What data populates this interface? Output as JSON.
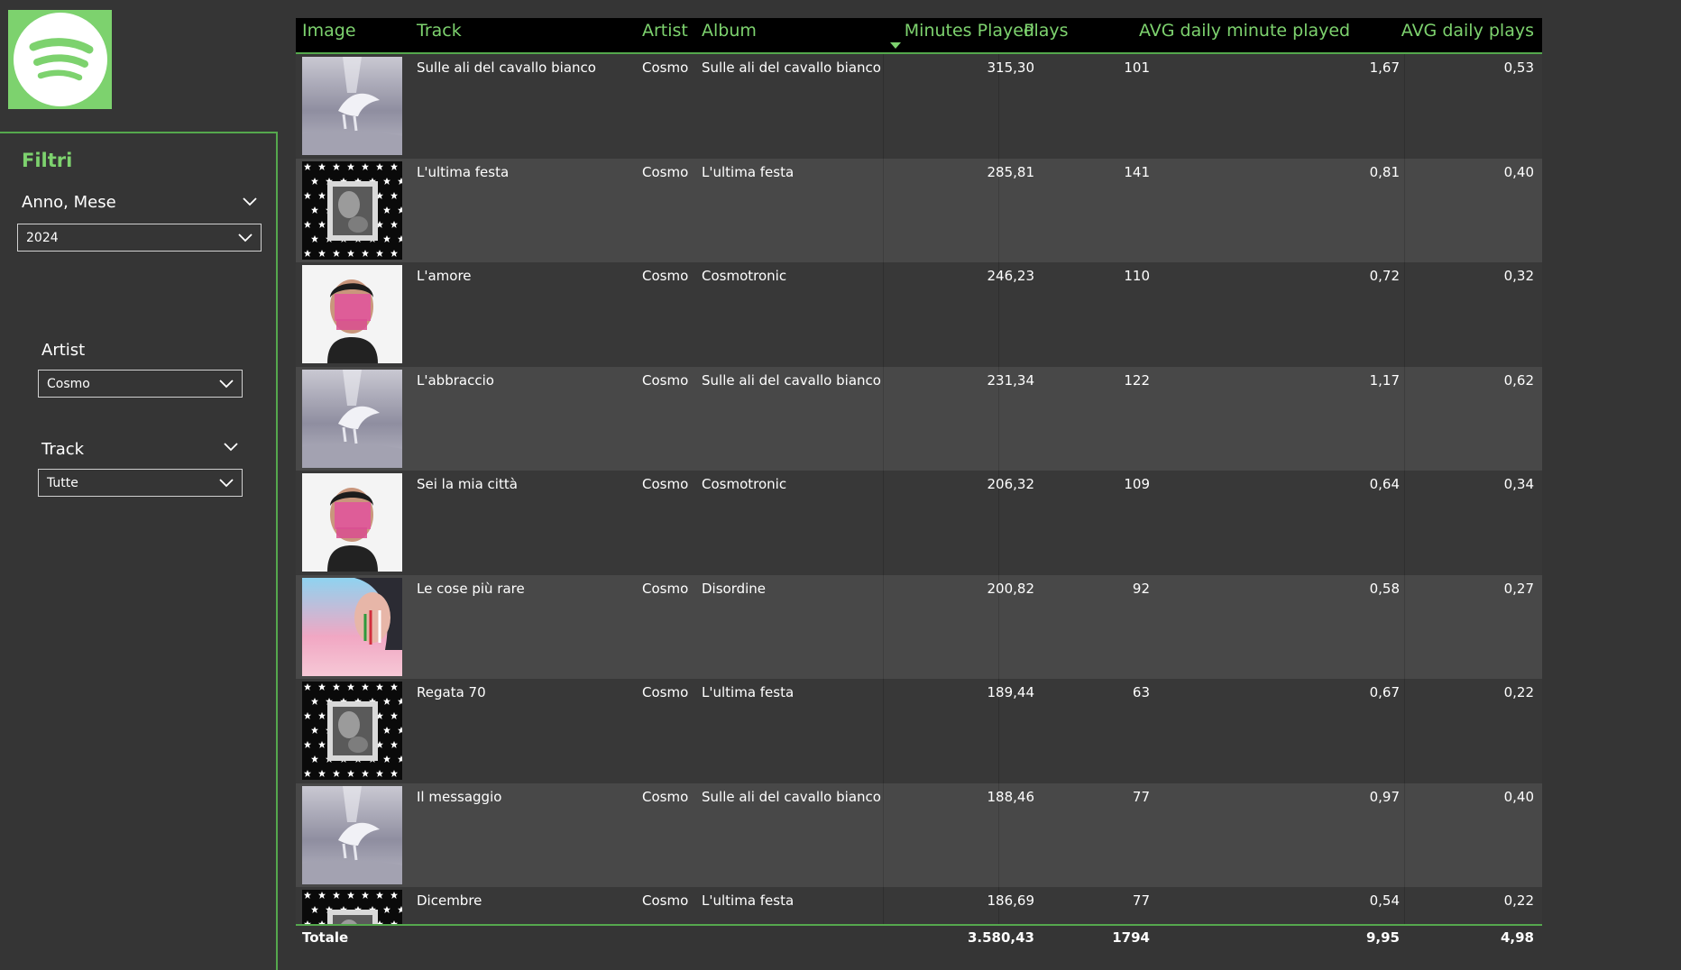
{
  "filters": {
    "title": "Filtri",
    "slicers": [
      {
        "label": "Anno, Mese",
        "value": "2024"
      },
      {
        "label": "Artist",
        "value": "Cosmo"
      },
      {
        "label": "Track",
        "value": "Tutte"
      }
    ]
  },
  "table": {
    "columns": [
      "Image",
      "Track",
      "Artist",
      "Album",
      "Minutes Played",
      "Plays",
      "AVG daily minute played",
      "AVG daily plays"
    ],
    "sorted_column": "Minutes Played",
    "sort_direction": "descending",
    "rows": [
      {
        "art": "pegasus",
        "track": "Sulle ali del cavallo bianco",
        "artist": "Cosmo",
        "album": "Sulle ali del cavallo bianco",
        "minutes": "315,30",
        "plays": "101",
        "avg_min": "1,67",
        "avg_plays": "0,53"
      },
      {
        "art": "stars",
        "track": "L'ultima festa",
        "artist": "Cosmo",
        "album": "L'ultima festa",
        "minutes": "285,81",
        "plays": "141",
        "avg_min": "0,81",
        "avg_plays": "0,40"
      },
      {
        "art": "cosmotronic",
        "track": "L'amore",
        "artist": "Cosmo",
        "album": "Cosmotronic",
        "minutes": "246,23",
        "plays": "110",
        "avg_min": "0,72",
        "avg_plays": "0,32"
      },
      {
        "art": "pegasus",
        "track": "L'abbraccio",
        "artist": "Cosmo",
        "album": "Sulle ali del cavallo bianco",
        "minutes": "231,34",
        "plays": "122",
        "avg_min": "1,17",
        "avg_plays": "0,62"
      },
      {
        "art": "cosmotronic",
        "track": "Sei la mia città",
        "artist": "Cosmo",
        "album": "Cosmotronic",
        "minutes": "206,32",
        "plays": "109",
        "avg_min": "0,64",
        "avg_plays": "0,34"
      },
      {
        "art": "disordine",
        "track": "Le cose più rare",
        "artist": "Cosmo",
        "album": "Disordine",
        "minutes": "200,82",
        "plays": "92",
        "avg_min": "0,58",
        "avg_plays": "0,27"
      },
      {
        "art": "stars",
        "track": "Regata 70",
        "artist": "Cosmo",
        "album": "L'ultima festa",
        "minutes": "189,44",
        "plays": "63",
        "avg_min": "0,67",
        "avg_plays": "0,22"
      },
      {
        "art": "pegasus",
        "track": "Il messaggio",
        "artist": "Cosmo",
        "album": "Sulle ali del cavallo bianco",
        "minutes": "188,46",
        "plays": "77",
        "avg_min": "0,97",
        "avg_plays": "0,40"
      },
      {
        "art": "stars",
        "track": "Dicembre",
        "artist": "Cosmo",
        "album": "L'ultima festa",
        "minutes": "186,69",
        "plays": "77",
        "avg_min": "0,54",
        "avg_plays": "0,22"
      }
    ],
    "total": {
      "label": "Totale",
      "minutes": "3.580,43",
      "plays": "1794",
      "avg_min": "9,95",
      "avg_plays": "4,98"
    }
  },
  "colors": {
    "accent": "#7dd26e",
    "background": "#353535",
    "header_bg": "#000000",
    "row_odd": "#383838",
    "row_even": "#484848"
  },
  "icons": {
    "logo": "spotify-logo-icon",
    "dropdown": "chevron-down-icon"
  }
}
